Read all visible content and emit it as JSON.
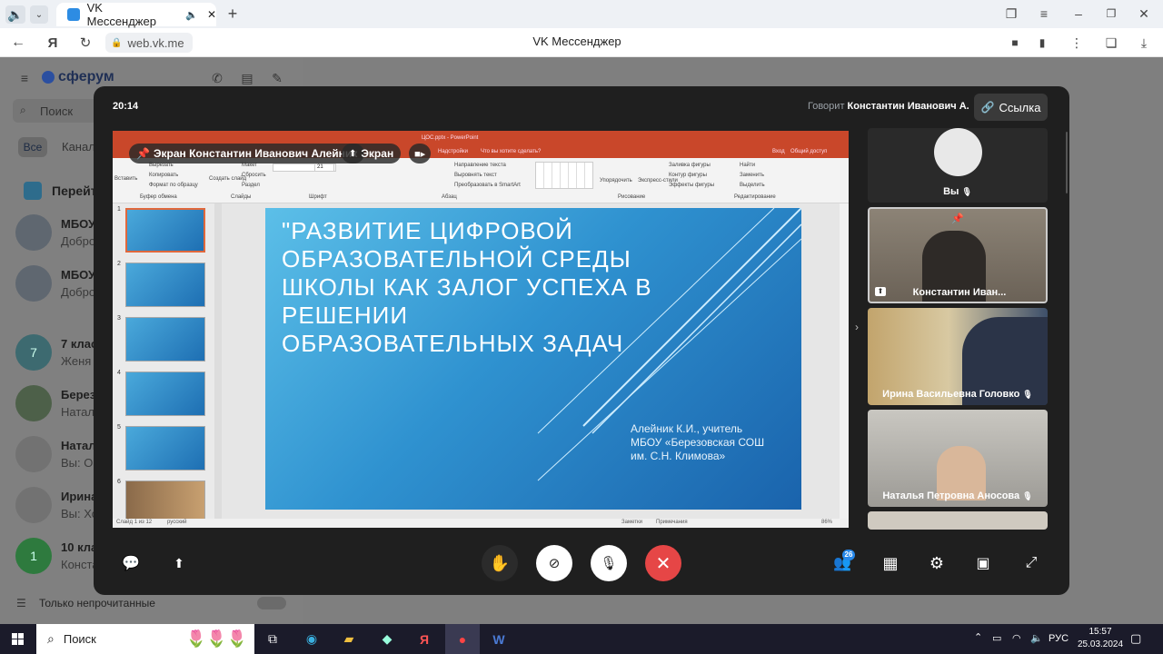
{
  "browser": {
    "tab_title": "VK Мессенджер",
    "url": "web.vk.me",
    "page_title": "VK Мессенджер"
  },
  "messenger": {
    "logo": "сферум",
    "search_placeholder": "Поиск",
    "filters": [
      "Все",
      "Канал"
    ],
    "banner": "Перейт",
    "chats": [
      {
        "name": "МБОУ",
        "preview": "Добро"
      },
      {
        "name": "МБОУ",
        "preview": "Добро"
      },
      {
        "name": "7 клас",
        "preview": "Женя Т",
        "avatar_text": "7"
      },
      {
        "name": "Березо",
        "preview": "Натал"
      },
      {
        "name": "Натал",
        "preview": "Вы: Ок"
      },
      {
        "name": "Ирина",
        "preview": "Вы: Хо"
      },
      {
        "name": "10 кла",
        "preview": "Конста",
        "avatar_text": "1"
      }
    ],
    "unread_only_label": "Только непрочитанные"
  },
  "call": {
    "time": "20:14",
    "speaking_label": "Говорит",
    "speaker": "Константин Иванович А.",
    "link_button": "Ссылка",
    "screen_owner": "Экран Константин Иванович Алейник",
    "screen_chip": "Экран",
    "participants_count": "26",
    "tiles": [
      {
        "name": "Вы"
      },
      {
        "name": "Константин Иван..."
      },
      {
        "name": "Ирина Васильевна Головко"
      },
      {
        "name": "Наталья Петровна Аносова"
      }
    ]
  },
  "ppt": {
    "file_title": "ЦОС.pptx - PowerPoint",
    "tell_me": "Что вы хотите сделать?",
    "share": "Общий доступ",
    "signin": "Вход",
    "addins": "Надстройки",
    "ribbon": {
      "paste": "Вставить",
      "cut": "Вырезать",
      "copy": "Копировать",
      "format_painter": "Формат по образцу",
      "clipboard": "Буфер обмена",
      "new_slide": "Создать слайд",
      "layout": "Макет",
      "reset": "Сбросить",
      "section": "Раздел",
      "slides": "Слайды",
      "font": "Шрифт",
      "font_size": "21",
      "text_dir": "Направление текста",
      "align_text": "Выровнять текст",
      "smartart": "Преобразовать в SmartArt",
      "paragraph": "Абзац",
      "arrange": "Упорядочить",
      "quick_styles": "Экспресс-стили",
      "fill": "Заливка фигуры",
      "outline": "Контур фигуры",
      "effects": "Эффекты фигуры",
      "drawing": "Рисование",
      "find": "Найти",
      "replace": "Заменить",
      "select": "Выделить",
      "editing": "Редактирование"
    },
    "thumb_numbers": [
      "1",
      "2",
      "3",
      "4",
      "5",
      "6"
    ],
    "slide_title": "\"РАЗВИТИЕ ЦИФРОВОЙ ОБРАЗОВАТЕЛЬНОЙ СРЕДЫ ШКОЛЫ КАК ЗАЛОГ УСПЕХА В РЕШЕНИИ ОБРАЗОВАТЕЛЬНЫХ ЗАДАЧ",
    "slide_author": [
      "Алейник К.И., учитель",
      "МБОУ «Березовская СОШ",
      "им. С.Н. Климова»"
    ],
    "status_slide": "Слайд 1 из 12",
    "status_lang": "русский",
    "status_notes": "Заметки",
    "status_comments": "Примечания",
    "zoom": "86%"
  },
  "taskbar": {
    "search": "Поиск",
    "lang": "РУС",
    "time": "15:57",
    "date": "25.03.2024"
  },
  "colors": {
    "accent_red": "#e64646",
    "ppt_orange": "#c9472a",
    "vk_blue": "#2688eb"
  }
}
